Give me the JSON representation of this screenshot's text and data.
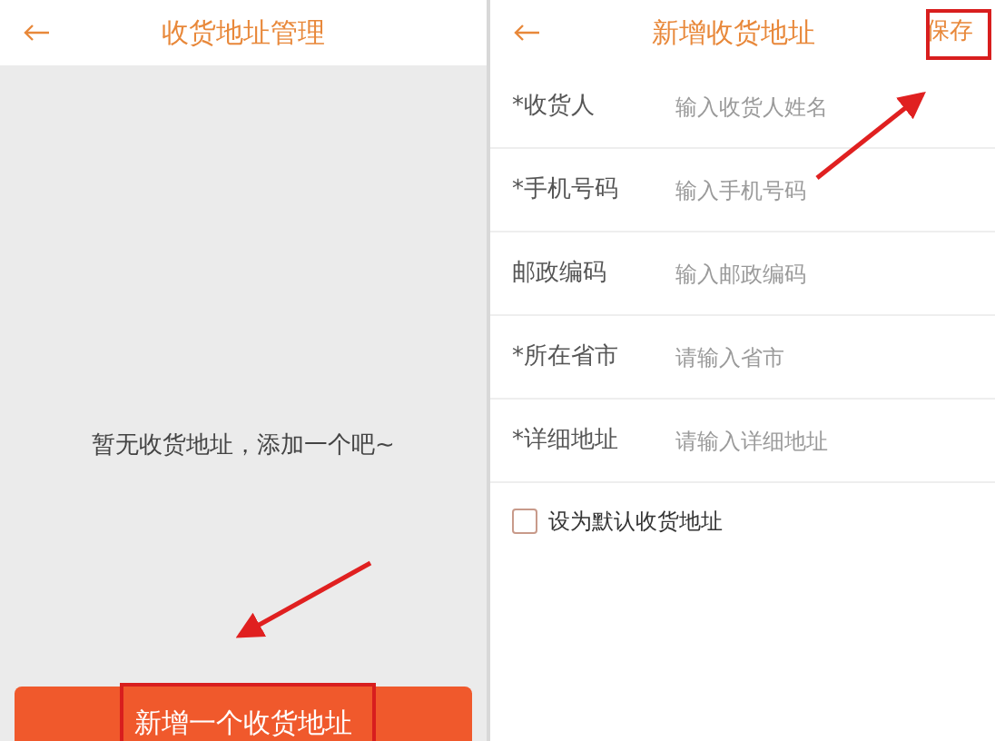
{
  "address_list_screen": {
    "title": "收货地址管理",
    "empty_message": "暂无收货地址，添加一个吧~",
    "add_button": "新增一个收货地址"
  },
  "new_address_screen": {
    "title": "新增收货地址",
    "save_button": "保存",
    "fields": [
      {
        "label": "*收货人",
        "placeholder": "输入收货人姓名"
      },
      {
        "label": "*手机号码",
        "placeholder": "输入手机号码"
      },
      {
        "label": "邮政编码",
        "placeholder": "输入邮政编码"
      },
      {
        "label": "*所在省市",
        "placeholder": "请输入省市"
      },
      {
        "label": "*详细地址",
        "placeholder": "请输入详细地址"
      }
    ],
    "default_checkbox": {
      "label": "设为默认收货地址",
      "checked": false
    }
  }
}
